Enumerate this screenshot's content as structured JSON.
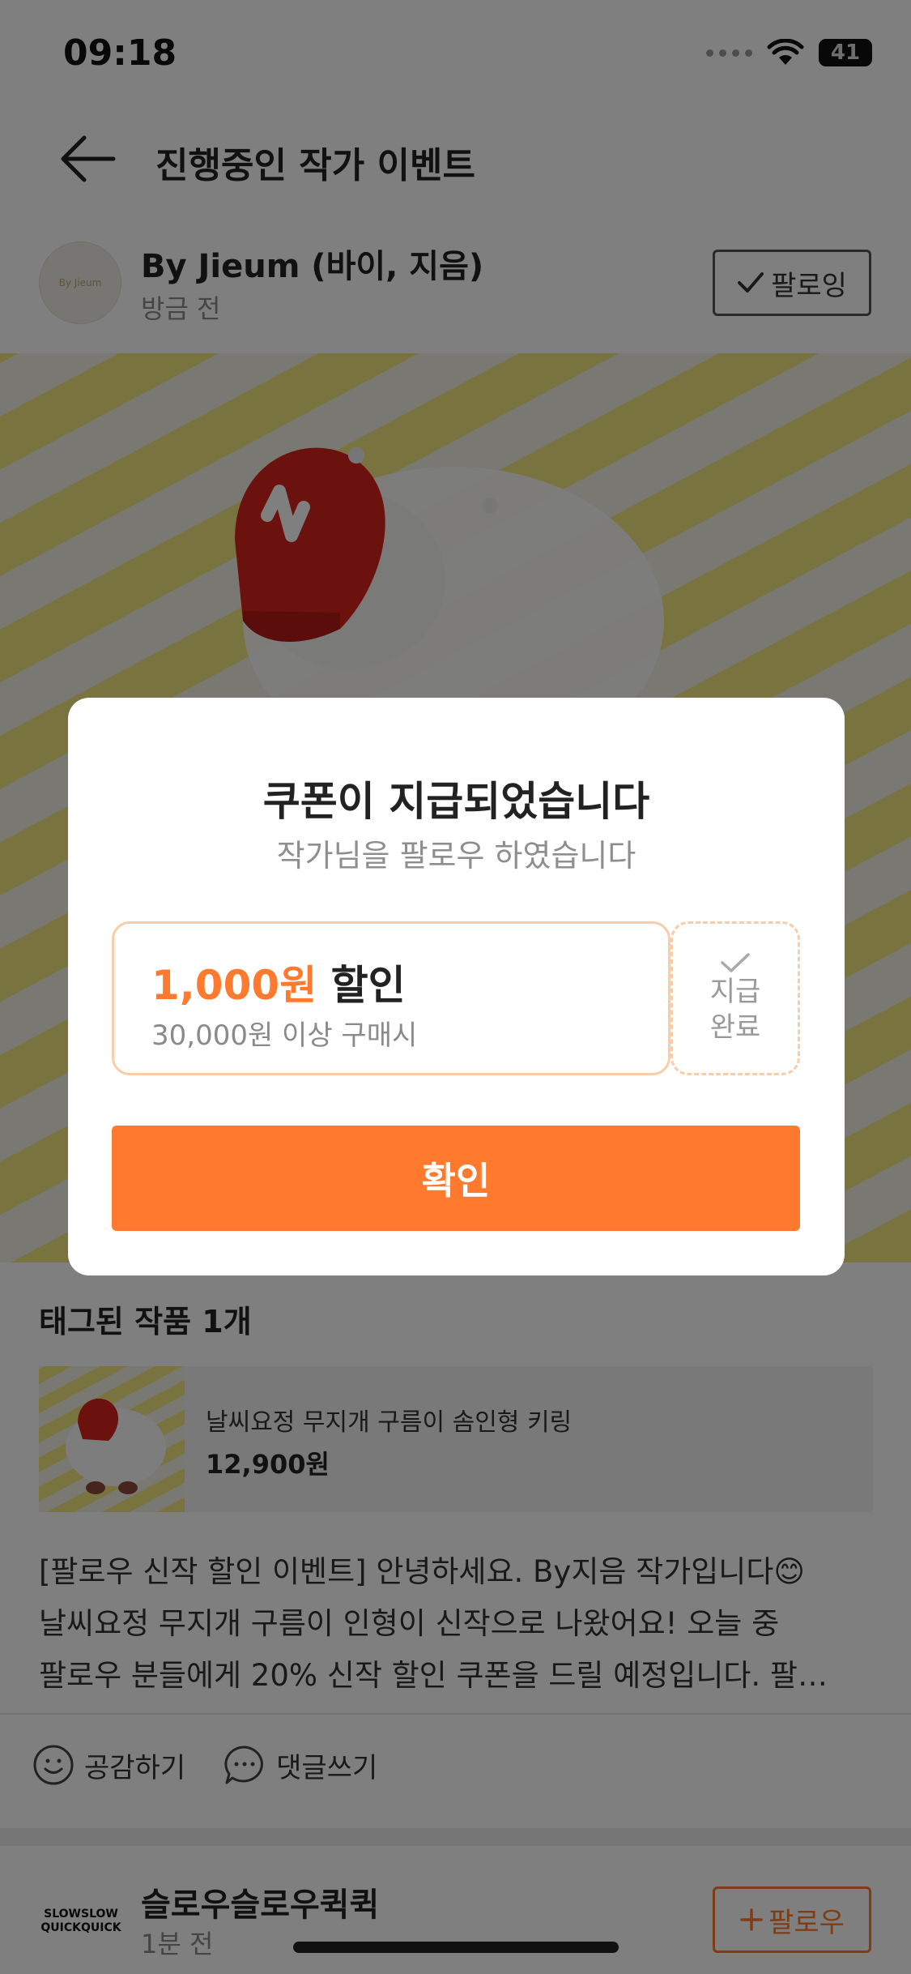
{
  "status_bar": {
    "time": "09:18",
    "battery": "41"
  },
  "header": {
    "title": "진행중인 작가 이벤트"
  },
  "author": {
    "name": "By Jieum (바이, 지음)",
    "time": "방금 전",
    "follow_state_label": "팔로잉",
    "avatar_text": "By Jieum"
  },
  "tagged": {
    "title": "태그된 작품 1개",
    "product": {
      "name": "날씨요정 무지개 구름이 솜인형 키링",
      "price": "12,900원"
    }
  },
  "post": {
    "lines": [
      "[팔로우 신작 할인 이벤트] 안녕하세요. By지음 작가입니다😊",
      "날씨요정 무지개 구름이 인형이 신작으로 나왔어요! 오늘 중",
      "팔로우 분들에게 20% 신작 할인 쿠폰을 드릴 예정입니다. 팔…"
    ]
  },
  "reactions": {
    "like_label": "공감하기",
    "comment_label": "댓글쓰기"
  },
  "next_author": {
    "name": "슬로우슬로우퀵퀵",
    "time": "1분 전",
    "follow_label": "팔로우",
    "logo_line1": "SLOWSLOW",
    "logo_line2": "QUICKQUICK"
  },
  "modal": {
    "title": "쿠폰이 지급되었습니다",
    "subtitle": "작가님을 팔로우 하였습니다",
    "coupon": {
      "amount": "1,000원",
      "discount_label": "할인",
      "condition": "30,000원 이상 구매시",
      "status_line1": "지급",
      "status_line2": "완료"
    },
    "confirm_label": "확인"
  },
  "colors": {
    "accent": "#ff7a2f",
    "coupon_border": "#f8cda8",
    "overlay": "rgba(0,0,0,0.5)"
  }
}
